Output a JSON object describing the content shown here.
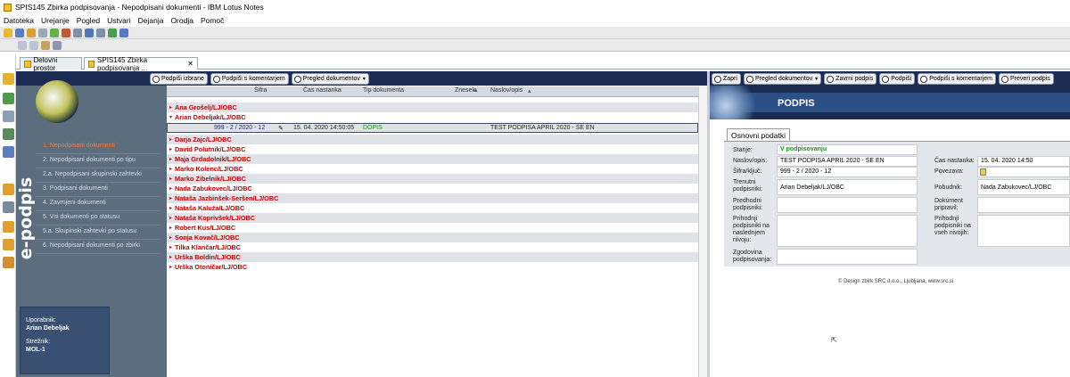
{
  "window": {
    "title": "SPIS145 Zbirka podpisovanja - Nepodpisani dokumenti - IBM Lotus Notes"
  },
  "menu": [
    "Datoteka",
    "Urejanje",
    "Pogled",
    "Ustvari",
    "Dejanja",
    "Orodja",
    "Pomoč"
  ],
  "tabs": [
    {
      "label": "Delovni prostor"
    },
    {
      "label": "SPIS145 Zbirka podpisovanja ...",
      "close": "✕"
    }
  ],
  "nav": {
    "brand": "e-podpis",
    "items": [
      {
        "label": "1. Nepodpisani dokumenti",
        "active": true
      },
      {
        "label": "2. Nepodpisani dokumenti po tipu"
      },
      {
        "label": "2.a. Nepodpisani skupinski zahtevki"
      },
      {
        "label": "3. Podpisani dokumenti"
      },
      {
        "label": "4. Zavrnjeni dokumenti"
      },
      {
        "label": "5. Vsi dokumenti po statusu"
      },
      {
        "label": "5.a. Skupinski zahtevki po statusu"
      },
      {
        "label": "6. Nepodpisani dokumenti po zbirki"
      }
    ],
    "user": {
      "user_label": "Uporabnik:",
      "user_value": "Arian Debeljak",
      "server_label": "Strežnik:",
      "server_value": "MOL-1"
    }
  },
  "view": {
    "buttons": {
      "sign_selected": "Podpiši izbrane",
      "sign_comment": "Podpiši s komentarjem",
      "view_docs": "Pregled dokumentov"
    },
    "columns": {
      "sifra": "Šifra",
      "cas": "Čas nastanka",
      "tip": "Tip dokumenta",
      "znesek": "Znesek",
      "naslov": "Naslov/opis"
    },
    "groups": [
      {
        "name": "Ana Grošelj/LJ/OBC",
        "expanded": false
      },
      {
        "name": "Arian Debeljak/LJ/OBC",
        "expanded": true
      },
      {
        "name": "Darja Zajc/LJ/OBC",
        "expanded": false
      },
      {
        "name": "David Polutnik/LJ/OBC",
        "expanded": false
      },
      {
        "name": "Maja Grdadolnik/LJ/OBC",
        "expanded": false
      },
      {
        "name": "Marko Kolenc/LJ/OBC",
        "expanded": false
      },
      {
        "name": "Marko Zibelnik/LJ/OBC",
        "expanded": false
      },
      {
        "name": "Nada Zabukovec/LJ/OBC",
        "expanded": false
      },
      {
        "name": "Nataša Jazbinšek-Seršen/LJ/OBC",
        "expanded": false
      },
      {
        "name": "Nataša Kaluža/LJ/OBC",
        "expanded": false
      },
      {
        "name": "Nataša Koprivšek/LJ/OBC",
        "expanded": false
      },
      {
        "name": "Robert Kus/LJ/OBC",
        "expanded": false
      },
      {
        "name": "Sonja Kovač/LJ/OBC",
        "expanded": false
      },
      {
        "name": "Tilka Klančar/LJ/OBC",
        "expanded": false
      },
      {
        "name": "Urška Boldin/LJ/OBC",
        "expanded": false
      },
      {
        "name": "Urška Otoničar/LJ/OBC",
        "expanded": false
      }
    ],
    "doc": {
      "sifra": "999 - 2 / 2020 - 12",
      "cas": "15. 04. 2020 14:50:05",
      "tip": "DOPIS",
      "naslov": "TEST PODPISA APRIL 2020 - ŠE EN"
    }
  },
  "doc": {
    "buttons": {
      "close": "Zapri",
      "view_docs": "Pregled dokumentov",
      "reject": "Zavrni podpis",
      "sign": "Podpiši",
      "sign_comment": "Podpiši s komentarjem",
      "verify": "Preveri podpis"
    },
    "banner_title": "PODPIS",
    "tab": "Osnovni podatki",
    "fields": {
      "stanje_l": "Stanje:",
      "stanje_v": "V podpisovanju",
      "naslov_l": "Naslov/opis:",
      "naslov_v": "TEST PODPISA APRIL 2020 - ŠE EN",
      "sifra_l": "Šifra/ključ:",
      "sifra_v": "999 - 2 / 2020 - 12",
      "trenutni_l": "Trenutni podpisniki:",
      "trenutni_v": "Arian Debeljak/LJ/OBC",
      "predhodni_l": "Predhodni podpisniki:",
      "prihodnji_l": "Prihodnji podpisniki na naslednjem nivoju:",
      "zgodovina_l": "Zgodovina podpisovanja:",
      "cas_l": "Čas nastanka:",
      "cas_v": "15. 04. 2020 14:50",
      "povezava_l": "Povezava:",
      "pobudnik_l": "Pobudnik:",
      "pobudnik_v": "Nada Zabukovec/LJ/OBC",
      "pripravil_l": "Dokument pripravil:",
      "prihodnji_vsi_l": "Prihodnji podpisniki na vseh nivojih:"
    },
    "footer": "© Design zbirk SRC d.o.o., Ljubljana, www.src.si"
  },
  "colors": {
    "navy": "#1b2b52",
    "nav_bg": "#5c6d7e",
    "group_red": "#c00000",
    "active_orange": "#ff7a33",
    "status_green": "#1a8f1a"
  }
}
